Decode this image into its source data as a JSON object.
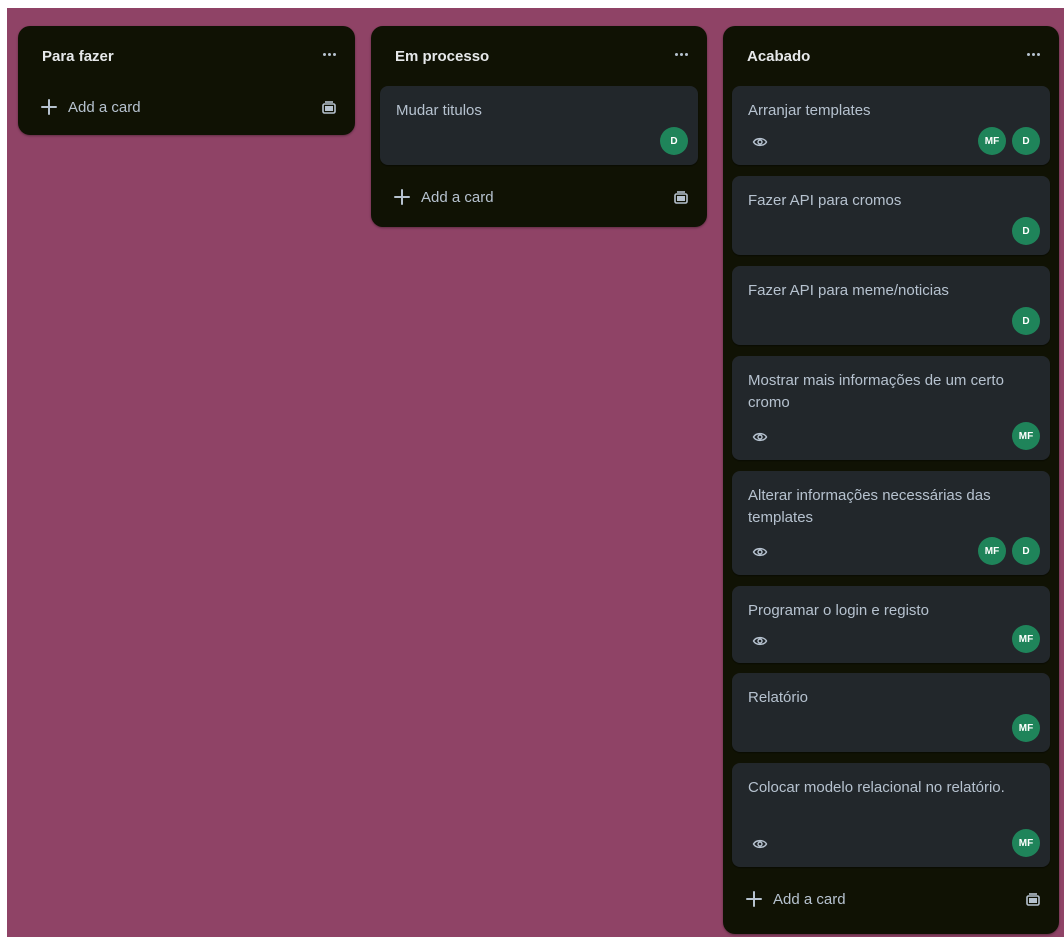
{
  "colors": {
    "board_background": "#8f4366",
    "list_background": "#101204",
    "card_background": "#22272b",
    "avatar_background": "#1f845a"
  },
  "board": {
    "lists": [
      {
        "title": "Para fazer",
        "menu_icon": "ellipsis-icon",
        "cards": [],
        "add_card_label": "Add a card"
      },
      {
        "title": "Em processo",
        "menu_icon": "ellipsis-icon",
        "cards": [
          {
            "title": "Mudar titulos",
            "watched": false,
            "members": [
              "D"
            ]
          }
        ],
        "add_card_label": "Add a card"
      },
      {
        "title": "Acabado",
        "menu_icon": "ellipsis-icon",
        "cards": [
          {
            "title": "Arranjar templates",
            "watched": true,
            "members": [
              "MF",
              "D"
            ]
          },
          {
            "title": "Fazer API para cromos",
            "watched": false,
            "members": [
              "D"
            ]
          },
          {
            "title": "Fazer API para meme/noticias",
            "watched": false,
            "members": [
              "D"
            ]
          },
          {
            "title": "Mostrar mais informações de um certo cromo",
            "watched": true,
            "members": [
              "MF"
            ]
          },
          {
            "title": "Alterar informações necessárias das templates",
            "watched": true,
            "members": [
              "MF",
              "D"
            ]
          },
          {
            "title": "Programar o login e registo",
            "watched": true,
            "members": [
              "MF"
            ]
          },
          {
            "title": "Relatório",
            "watched": false,
            "members": [
              "MF"
            ]
          },
          {
            "title": "Colocar modelo relacional no relatório.",
            "watched": true,
            "members": [
              "MF"
            ]
          }
        ],
        "add_card_label": "Add a card"
      }
    ]
  }
}
